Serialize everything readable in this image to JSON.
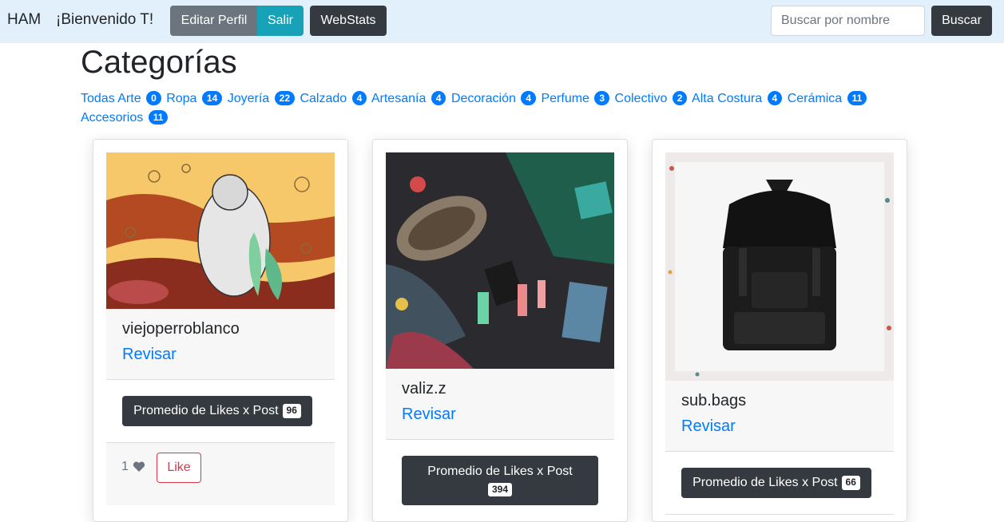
{
  "navbar": {
    "brand": "HAM",
    "welcome": "¡Bienvenido T!",
    "edit_profile": "Editar Perfil",
    "logout": "Salir",
    "webstats": "WebStats",
    "search_placeholder": "Buscar por nombre",
    "search_button": "Buscar"
  },
  "page": {
    "title": "Categorías"
  },
  "categories": [
    {
      "name": "Todas Arte",
      "count": "0"
    },
    {
      "name": "Ropa",
      "count": "14"
    },
    {
      "name": "Joyería",
      "count": "22"
    },
    {
      "name": "Calzado",
      "count": "4"
    },
    {
      "name": "Artesanía",
      "count": "4"
    },
    {
      "name": "Decoración",
      "count": "4"
    },
    {
      "name": "Perfume",
      "count": "3"
    },
    {
      "name": "Colectivo",
      "count": "2"
    },
    {
      "name": "Alta Costura",
      "count": "4"
    },
    {
      "name": "Cerámica",
      "count": "11"
    },
    {
      "name": "Accesorios",
      "count": "11"
    }
  ],
  "cards": [
    {
      "username": "viejoperroblanco",
      "review_label": "Revisar",
      "likes_label": "Promedio de Likes x Post",
      "likes_avg": "96",
      "like_count": "1",
      "like_button": "Like"
    },
    {
      "username": "valiz.z",
      "review_label": "Revisar",
      "likes_label": "Promedio de Likes x Post",
      "likes_avg": "394"
    },
    {
      "username": "sub.bags",
      "review_label": "Revisar",
      "likes_label": "Promedio de Likes x Post",
      "likes_avg": "66"
    }
  ],
  "colors": {
    "link": "#007bff",
    "dark": "#343a40",
    "info": "#17a2b8",
    "secondary": "#6c757d",
    "danger": "#dc3545",
    "navbar": "#e2f0fb"
  }
}
